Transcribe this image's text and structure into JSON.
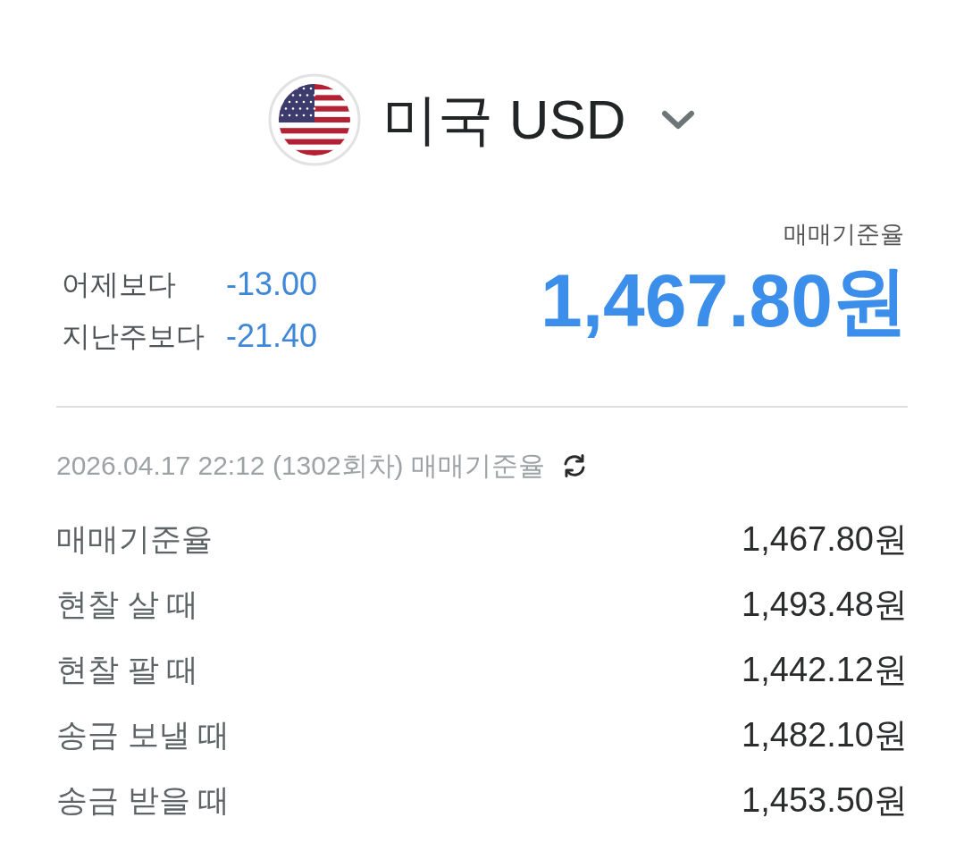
{
  "header": {
    "title": "미국 USD"
  },
  "summary": {
    "changes": [
      {
        "label": "어제보다",
        "value": "-13.00",
        "falling": true
      },
      {
        "label": "지난주보다",
        "value": "-21.40",
        "falling": true
      }
    ],
    "rate_label": "매매기준율",
    "rate": "1,467.80원",
    "falling": true
  },
  "update": {
    "text": "2026.04.17 22:12 (1302회차) 매매기준율"
  },
  "rates": [
    {
      "label": "매매기준율",
      "value": "1,467.80원"
    },
    {
      "label": "현찰 살 때",
      "value": "1,493.48원"
    },
    {
      "label": "현찰 팔 때",
      "value": "1,442.12원"
    },
    {
      "label": "송금 보낼 때",
      "value": "1,482.10원"
    },
    {
      "label": "송금 받을 때",
      "value": "1,453.50원"
    }
  ]
}
